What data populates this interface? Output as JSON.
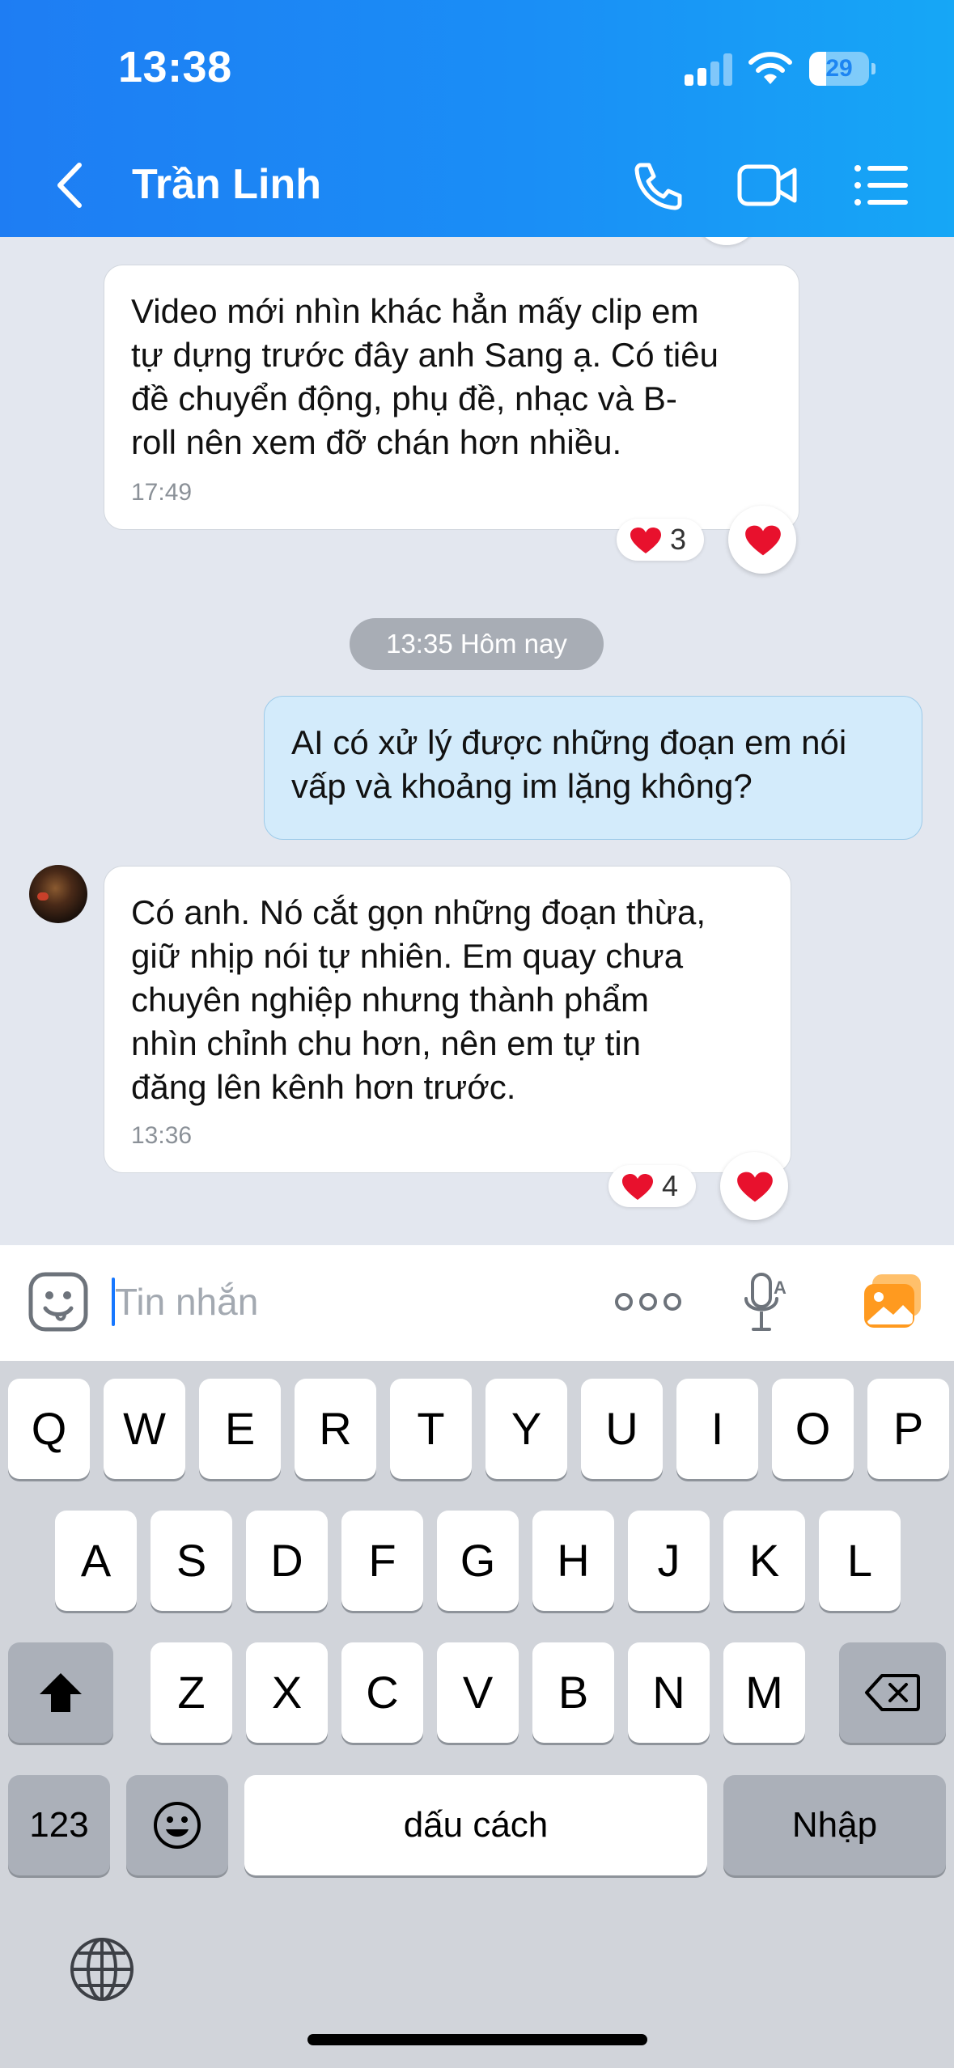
{
  "status_bar": {
    "time": "13:38",
    "battery": "29",
    "battery_level": 0.29
  },
  "header": {
    "contact_name": "Trần Linh"
  },
  "messages": [
    {
      "text": [
        "Video mới nhìn khác hẳn mấy clip em",
        "tự dựng trước đây anh Sang ạ. Có tiêu",
        "đề chuyển động, phụ đề, nhạc và B-",
        "roll nên xem đỡ chán hơn nhiều."
      ],
      "time": "17:49",
      "reaction_count": "3"
    },
    {
      "text": [
        "AI có xử lý được những đoạn em nói",
        "vấp và khoảng im lặng không?"
      ]
    },
    {
      "text": [
        "Có anh. Nó cắt gọn những đoạn thừa,",
        "giữ nhịp nói tự nhiên. Em quay chưa",
        "chuyên nghiệp nhưng thành phẩm",
        "nhìn chỉnh chu hơn, nên em tự tin",
        "đăng lên kênh hơn trước."
      ],
      "time": "13:36",
      "reaction_count": "4"
    }
  ],
  "date_separator": "13:35 Hôm nay",
  "input": {
    "placeholder": "Tin nhắn",
    "value": ""
  },
  "keyboard": {
    "row1": [
      "Q",
      "W",
      "E",
      "R",
      "T",
      "Y",
      "U",
      "I",
      "O",
      "P"
    ],
    "row2": [
      "A",
      "S",
      "D",
      "F",
      "G",
      "H",
      "J",
      "K",
      "L"
    ],
    "row3": [
      "Z",
      "X",
      "C",
      "V",
      "B",
      "N",
      "M"
    ],
    "numbers_label": "123",
    "space_label": "dấu cách",
    "return_label": "Nhập"
  },
  "icons": {
    "back": "chevron-left-icon",
    "call": "phone-icon",
    "video": "video-camera-icon",
    "menu": "list-menu-icon",
    "sticker": "sticker-face-icon",
    "more": "more-dots-icon",
    "voice": "voice-to-text-icon",
    "image": "gallery-icon",
    "heart": "heart-icon",
    "shift": "shift-icon",
    "delete": "backspace-icon",
    "emoji": "emoji-icon",
    "globe": "globe-icon"
  },
  "colors": {
    "header_start": "#1e7df3",
    "header_end": "#16a7f6",
    "my_bubble": "#d3ebfb",
    "heart": "#e8112d",
    "gallery": "#ff9a1f"
  }
}
